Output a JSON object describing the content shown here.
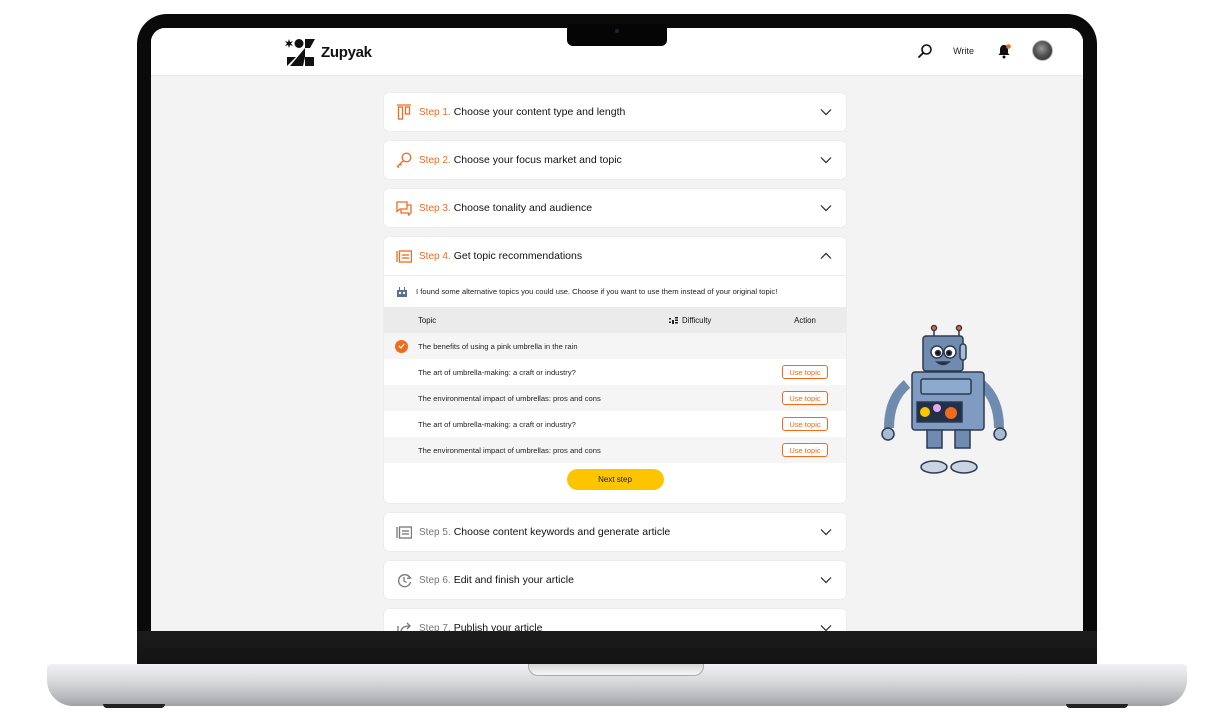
{
  "app": {
    "brand": "Zupyak",
    "nav": {
      "search_icon": "search-icon",
      "write_label": "Write",
      "bell_icon": "bell-icon",
      "avatar": "user-avatar"
    }
  },
  "colors": {
    "accent": "#f26b1d",
    "primary_button": "#fcc500",
    "background": "#f3f3f3"
  },
  "steps": [
    {
      "number": "Step 1.",
      "title": "Choose your content type and length",
      "icon": "columns-icon",
      "state": "collapsed"
    },
    {
      "number": "Step 2.",
      "title": "Choose your focus market and topic",
      "icon": "key-icon",
      "state": "collapsed"
    },
    {
      "number": "Step 3.",
      "title": "Choose tonality and audience",
      "icon": "chat-icon",
      "state": "collapsed"
    },
    {
      "number": "Step 4.",
      "title": "Get topic recommendations",
      "icon": "list-icon",
      "state": "expanded"
    },
    {
      "number": "Step 5.",
      "title": "Choose content keywords and generate article",
      "icon": "list-icon",
      "state": "collapsed"
    },
    {
      "number": "Step 6.",
      "title": "Edit and finish your article",
      "icon": "clock-refresh-icon",
      "state": "collapsed"
    },
    {
      "number": "Step 7.",
      "title": "Publish your article",
      "icon": "share-icon",
      "state": "collapsed"
    }
  ],
  "recommendations": {
    "notice": "I found some alternative topics you could use. Choose if you want to use them instead of your original topic!",
    "columns": {
      "topic": "Topic",
      "difficulty": "Difficulty",
      "action": "Action"
    },
    "rows": [
      {
        "topic": "The benefits of using a pink umbrella in the rain",
        "selected": true,
        "action": ""
      },
      {
        "topic": "The art of umbrella-making: a craft or industry?",
        "selected": false,
        "action": "Use topic"
      },
      {
        "topic": "The environmental impact of umbrellas: pros and cons",
        "selected": false,
        "action": "Use topic"
      },
      {
        "topic": "The art of umbrella-making: a craft or industry?",
        "selected": false,
        "action": "Use topic"
      },
      {
        "topic": "The environmental impact of umbrellas: pros and cons",
        "selected": false,
        "action": "Use topic"
      }
    ],
    "next_label": "Next step"
  }
}
